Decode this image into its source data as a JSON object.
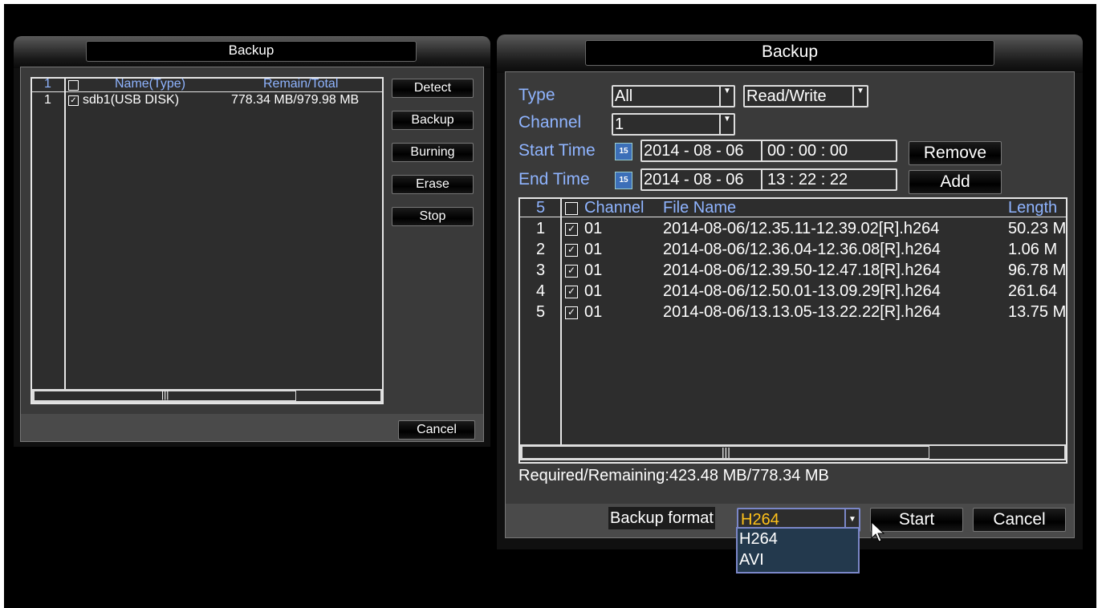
{
  "left_window": {
    "title": "Backup",
    "header": {
      "count": "1",
      "name": "Name(Type)",
      "remain": "Remain/Total"
    },
    "rows": [
      {
        "index": "1",
        "checked": true,
        "name": "sdb1(USB DISK)",
        "remain": "778.34 MB/979.98 MB"
      }
    ],
    "buttons": {
      "detect": "Detect",
      "backup": "Backup",
      "burning": "Burning",
      "erase": "Erase",
      "stop": "Stop",
      "cancel": "Cancel"
    }
  },
  "right_window": {
    "title": "Backup",
    "type_label": "Type",
    "type_value": "All",
    "mode_value": "Read/Write",
    "channel_label": "Channel",
    "channel_value": "1",
    "start_label": "Start Time",
    "start_date": "2014 - 08 - 06",
    "start_time": "00 :  00 :  00",
    "end_label": "End Time",
    "end_date": "2014 - 08 - 06",
    "end_time": "13 :  22 :  22",
    "remove_button": "Remove",
    "add_button": "Add",
    "calendar_icon_text": "15",
    "header": {
      "count": "5",
      "channel": "Channel",
      "file": "File Name",
      "length": "Length"
    },
    "rows": [
      {
        "index": "1",
        "checked": true,
        "channel": "01",
        "file": "2014-08-06/12.35.11-12.39.02[R].h264",
        "length": "50.23 M"
      },
      {
        "index": "2",
        "checked": true,
        "channel": "01",
        "file": "2014-08-06/12.36.04-12.36.08[R].h264",
        "length": "1.06 M"
      },
      {
        "index": "3",
        "checked": true,
        "channel": "01",
        "file": "2014-08-06/12.39.50-12.47.18[R].h264",
        "length": "96.78 M"
      },
      {
        "index": "4",
        "checked": true,
        "channel": "01",
        "file": "2014-08-06/12.50.01-13.09.29[R].h264",
        "length": "261.64"
      },
      {
        "index": "5",
        "checked": true,
        "channel": "01",
        "file": "2014-08-06/13.13.05-13.22.22[R].h264",
        "length": "13.75 M"
      }
    ],
    "required_remaining": "Required/Remaining:423.48 MB/778.34 MB",
    "backup_format_label": "Backup format",
    "backup_format_value": "H264",
    "format_options": [
      "H264",
      "AVI"
    ],
    "start_button": "Start",
    "cancel_button": "Cancel"
  },
  "colors": {
    "label_blue": "#8fb4ff",
    "format_value": "#ffc21a",
    "dropdown_bg": "#23394d"
  }
}
